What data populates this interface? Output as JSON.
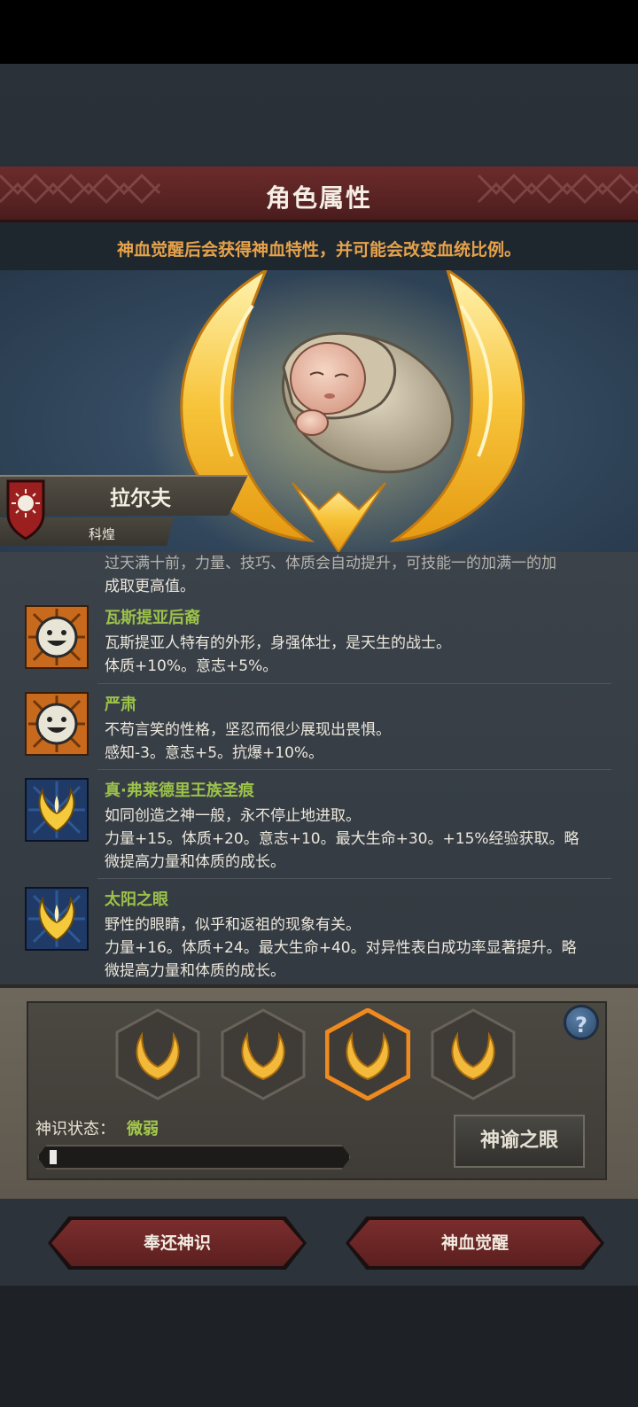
{
  "header": {
    "title": "角色属性"
  },
  "subtitle": "神血觉醒后会获得神血特性，并可能会改变血统比例。",
  "character": {
    "name": "拉尔夫",
    "origin": "科煌"
  },
  "traits_partial": {
    "cut_line": "过天满十前，力量、技巧、体质会自动提升，可技能一的加满一的加",
    "continued_line": "成取更高值。"
  },
  "traits": [
    {
      "name": "瓦斯提亚后裔",
      "icon": "smiley-face-icon",
      "lines": [
        "瓦斯提亚人特有的外形，身强体壮，是天生的战士。",
        "体质+10%。意志+5%。"
      ]
    },
    {
      "name": "严肃",
      "icon": "smiley-face-icon",
      "lines": [
        "不苟言笑的性格，坚忍而很少展现出畏惧。",
        "感知-3。意志+5。抗爆+10%。"
      ]
    },
    {
      "name": "真·弗莱德里王族圣痕",
      "icon": "divine-flame-icon",
      "lines": [
        "如同创造之神一般，永不停止地进取。",
        "力量+15。体质+20。意志+10。最大生命+30。+15%经验获取。略",
        "微提高力量和体质的成长。"
      ]
    },
    {
      "name": "太阳之眼",
      "icon": "divine-flame-icon",
      "lines": [
        "野性的眼睛，似乎和返祖的现象有关。",
        "力量+16。体质+24。最大生命+40。对异性表白成功率显著提升。略",
        "微提高力量和体质的成长。"
      ]
    }
  ],
  "divine_slots": [
    {
      "icon": "golden-wreath-icon",
      "selected": false
    },
    {
      "icon": "golden-wreath-icon",
      "selected": false
    },
    {
      "icon": "golden-wreath-icon",
      "selected": true
    },
    {
      "icon": "golden-wreath-icon",
      "selected": false
    }
  ],
  "help_label": "?",
  "divine_state": {
    "label": "神识状态：",
    "value": "微弱",
    "progress": 0.02
  },
  "oracle_eye_label": "神谕之眼",
  "actions": {
    "return_label": "奉还神识",
    "awaken_label": "神血觉醒"
  },
  "colors": {
    "accent_orange": "#e6a24b",
    "trait_green": "#9cc24a",
    "button_red": "#6b2626"
  }
}
